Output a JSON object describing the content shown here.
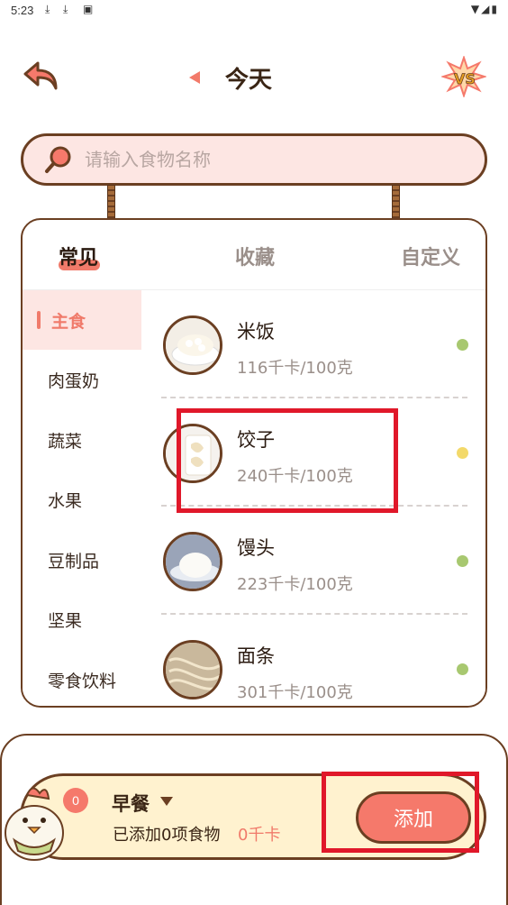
{
  "status_bar": {
    "time": "5:23",
    "notif_icons": [
      "download-icon",
      "download-icon",
      "accessibility-icon"
    ],
    "sys_icons": [
      "wifi-icon",
      "signal-icon",
      "battery-icon"
    ]
  },
  "header": {
    "title": "今天"
  },
  "search": {
    "placeholder": "请输入食物名称"
  },
  "tabs": [
    {
      "label": "常见",
      "active": true
    },
    {
      "label": "收藏",
      "active": false
    },
    {
      "label": "自定义",
      "active": false
    }
  ],
  "categories": [
    {
      "label": "主食",
      "active": true
    },
    {
      "label": "肉蛋奶"
    },
    {
      "label": "蔬菜"
    },
    {
      "label": "水果"
    },
    {
      "label": "豆制品"
    },
    {
      "label": "坚果"
    },
    {
      "label": "零食饮料"
    }
  ],
  "foods": [
    {
      "name": "米饭",
      "cal": "116千卡/100克",
      "dot_color": "#a8c870"
    },
    {
      "name": "饺子",
      "cal": "240千卡/100克",
      "dot_color": "#f3d96a"
    },
    {
      "name": "馒头",
      "cal": "223千卡/100克",
      "dot_color": "#a8c870"
    },
    {
      "name": "面条",
      "cal": "301千卡/100克",
      "dot_color": "#a8c870"
    }
  ],
  "meal": {
    "badge_count": "0",
    "title": "早餐",
    "subtitle": "已添加0项食物",
    "kcal": "0千卡",
    "add_label": "添加"
  },
  "colors": {
    "accent": "#f5796b",
    "border": "#6b3f22",
    "search_bg": "#fde6e3",
    "meal_bg": "#fff2cf"
  }
}
